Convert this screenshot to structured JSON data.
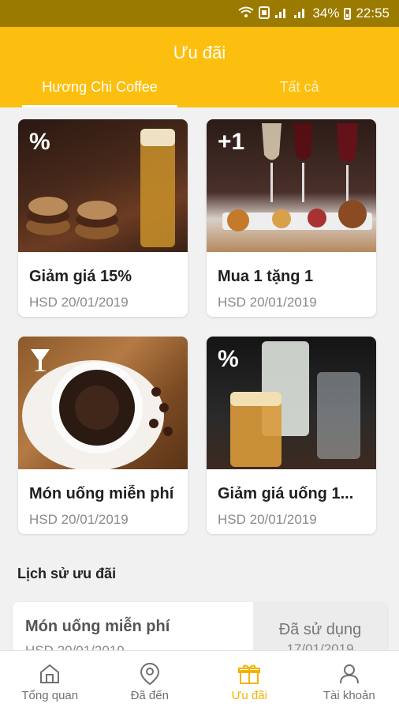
{
  "status_bar": {
    "battery": "34%",
    "time": "22:55"
  },
  "header": {
    "title": "Ưu đãi",
    "tabs": [
      {
        "label": "Hương Chi Coffee",
        "active": true
      },
      {
        "label": "Tất cả",
        "active": false
      }
    ]
  },
  "offers": [
    {
      "badge": "%",
      "name": "Giảm giá 15%",
      "hsd": "HSD 20/01/2019",
      "image": "burgers-beer"
    },
    {
      "badge": "+1",
      "name": "Mua 1 tặng 1",
      "hsd": "HSD 20/01/2019",
      "image": "wine-tapas"
    },
    {
      "badge": "cocktail-glass",
      "name": "Món uống miễn phí",
      "hsd": "HSD 20/01/2019",
      "image": "coffee-cup"
    },
    {
      "badge": "%",
      "name": "Giảm giá uống 1...",
      "hsd": "HSD 20/01/2019",
      "image": "drinks-glasses"
    }
  ],
  "history": {
    "section_title": "Lịch sử ưu đãi",
    "items": [
      {
        "name": "Món uống miễn phí",
        "hsd": "HSD 20/01/2019",
        "status": "Đã sử dụng",
        "used_date": "17/01/2019"
      }
    ]
  },
  "bottom_nav": [
    {
      "label": "Tổng quan",
      "icon": "home-icon",
      "active": false
    },
    {
      "label": "Đã đến",
      "icon": "location-pin-icon",
      "active": false
    },
    {
      "label": "Ưu đãi",
      "icon": "gift-icon",
      "active": true
    },
    {
      "label": "Tài khoản",
      "icon": "user-icon",
      "active": false
    }
  ],
  "colors": {
    "primary": "#fdbf0f",
    "status_bar": "#9b7a00",
    "active_nav": "#f3b400"
  }
}
